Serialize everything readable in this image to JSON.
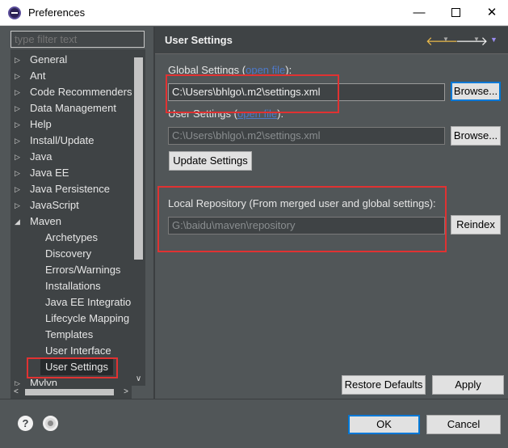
{
  "window": {
    "title": "Preferences",
    "minimize": "—",
    "close": "✕"
  },
  "filter": {
    "placeholder": "type filter text"
  },
  "tree": {
    "items": [
      {
        "label": "General",
        "arrow": "▷"
      },
      {
        "label": "Ant",
        "arrow": "▷"
      },
      {
        "label": "Code Recommenders",
        "arrow": "▷"
      },
      {
        "label": "Data Management",
        "arrow": "▷"
      },
      {
        "label": "Help",
        "arrow": "▷"
      },
      {
        "label": "Install/Update",
        "arrow": "▷"
      },
      {
        "label": "Java",
        "arrow": "▷"
      },
      {
        "label": "Java EE",
        "arrow": "▷"
      },
      {
        "label": "Java Persistence",
        "arrow": "▷"
      },
      {
        "label": "JavaScript",
        "arrow": "▷"
      },
      {
        "label": "Maven",
        "arrow": "◢"
      },
      {
        "label": "Archetypes"
      },
      {
        "label": "Discovery"
      },
      {
        "label": "Errors/Warnings"
      },
      {
        "label": "Installations"
      },
      {
        "label": "Java EE Integration"
      },
      {
        "label": "Lifecycle Mapping"
      },
      {
        "label": "Templates"
      },
      {
        "label": "User Interface"
      },
      {
        "label": "User Settings"
      },
      {
        "label": "Mylyn",
        "arrow": "▷"
      }
    ],
    "selected": "User Settings"
  },
  "page": {
    "title": "User Settings",
    "global_label_prefix": "Global Settings (",
    "global_link": "open file",
    "global_label_suffix": "):",
    "global_value": "C:\\Users\\bhlgo\\.m2\\settings.xml",
    "user_label_prefix": "User Settings (",
    "user_link": "open file",
    "user_label_suffix": "):",
    "user_value": "C:\\Users\\bhlgo\\.m2\\settings.xml",
    "browse_label": "Browse...",
    "update_label": "Update Settings",
    "local_repo_label": "Local Repository (From merged user and global settings):",
    "local_repo_value": "G:\\baidu\\maven\\repository",
    "reindex_label": "Reindex",
    "restore_label": "Restore Defaults",
    "apply_label": "Apply"
  },
  "footer": {
    "ok_label": "OK",
    "cancel_label": "Cancel",
    "help_icon_text": "?"
  },
  "colors": {
    "background": "#515658",
    "annotation": "#e03232",
    "link": "#4e79c9",
    "focus": "#0078d7"
  }
}
